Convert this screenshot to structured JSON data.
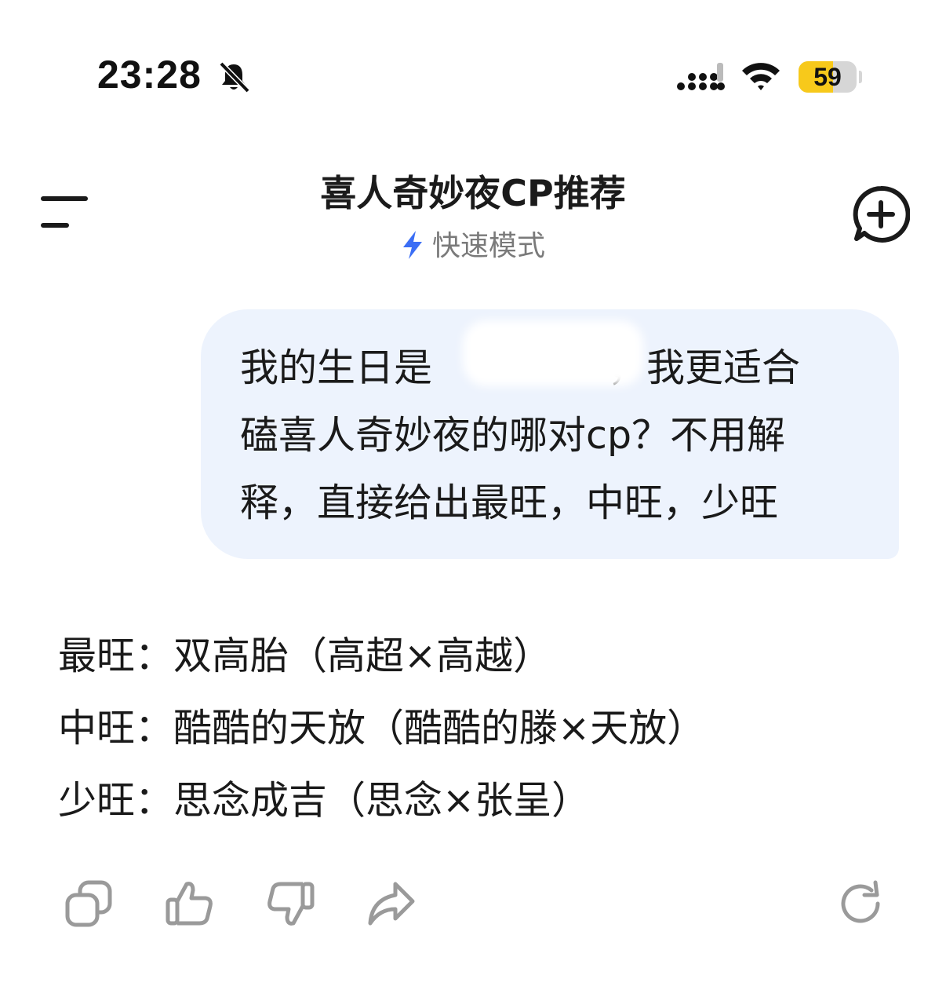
{
  "status_bar": {
    "time": "23:28",
    "battery_level": "59",
    "battery_fraction": 0.59,
    "icons": [
      "bell-muted-icon",
      "cellular-signal-icon",
      "wifi-icon",
      "battery-icon"
    ]
  },
  "header": {
    "title": "喜人奇妙夜CP推荐",
    "mode_label": "快速模式",
    "accent_color": "#3b6ef5",
    "icons": [
      "menu-icon",
      "lightning-icon",
      "new-chat-icon"
    ]
  },
  "user_message": {
    "line1_before": "我的生日是",
    "line1_after": "，我更适合",
    "line2": "磕喜人奇妙夜的哪对cp？不用解",
    "line3": "释，直接给出最旺，中旺，少旺",
    "bubble_color": "#edf3fd"
  },
  "assistant_reply": {
    "lines": [
      {
        "label": "最旺：",
        "text": "双高胎（高超×高越）"
      },
      {
        "label": "中旺：",
        "text": "酷酷的天放（酷酷的滕×天放）"
      },
      {
        "label": "少旺：",
        "text": "思念成吉（思念×张呈）"
      }
    ]
  },
  "actions": {
    "icons": [
      "copy-icon",
      "thumbs-up-icon",
      "thumbs-down-icon",
      "share-icon",
      "regenerate-icon"
    ],
    "icon_color": "#9a9a9a"
  }
}
